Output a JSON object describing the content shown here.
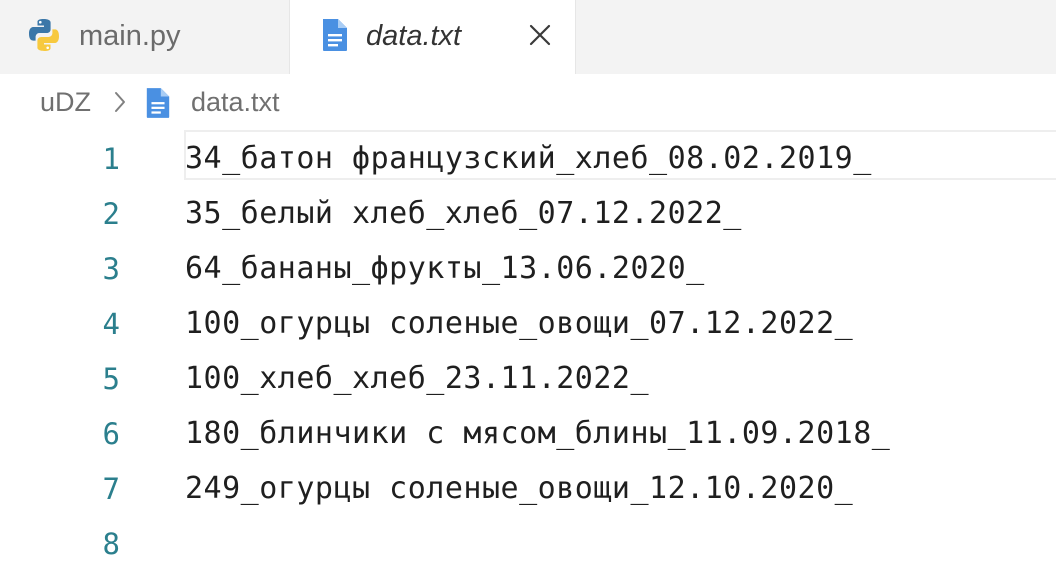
{
  "tabs": [
    {
      "label": "main.py",
      "icon": "python-icon",
      "active": false
    },
    {
      "label": "data.txt",
      "icon": "file-text-icon",
      "active": true,
      "close_icon": "close-icon"
    }
  ],
  "breadcrumb": {
    "root": "uDZ",
    "separator_icon": "chevron-right-icon",
    "file_icon": "file-text-icon",
    "file": "data.txt"
  },
  "editor": {
    "lines": [
      {
        "number": "1",
        "text": "34_батон французский_хлеб_08.02.2019_"
      },
      {
        "number": "2",
        "text": "35_белый хлеб_хлеб_07.12.2022_"
      },
      {
        "number": "3",
        "text": "64_бананы_фрукты_13.06.2020_"
      },
      {
        "number": "4",
        "text": "100_огурцы соленые_овощи_07.12.2022_"
      },
      {
        "number": "5",
        "text": "100_хлеб_хлеб_23.11.2022_"
      },
      {
        "number": "6",
        "text": "180_блинчики с мясом_блины_11.09.2018_"
      },
      {
        "number": "7",
        "text": "249_огурцы соленые_овощи_12.10.2020_"
      },
      {
        "number": "8",
        "text": ""
      }
    ]
  },
  "colors": {
    "line_number": "#2b7f8d",
    "file_icon": "#4a90e2",
    "python_blue": "#3b77a8",
    "python_yellow": "#f7c93e"
  }
}
